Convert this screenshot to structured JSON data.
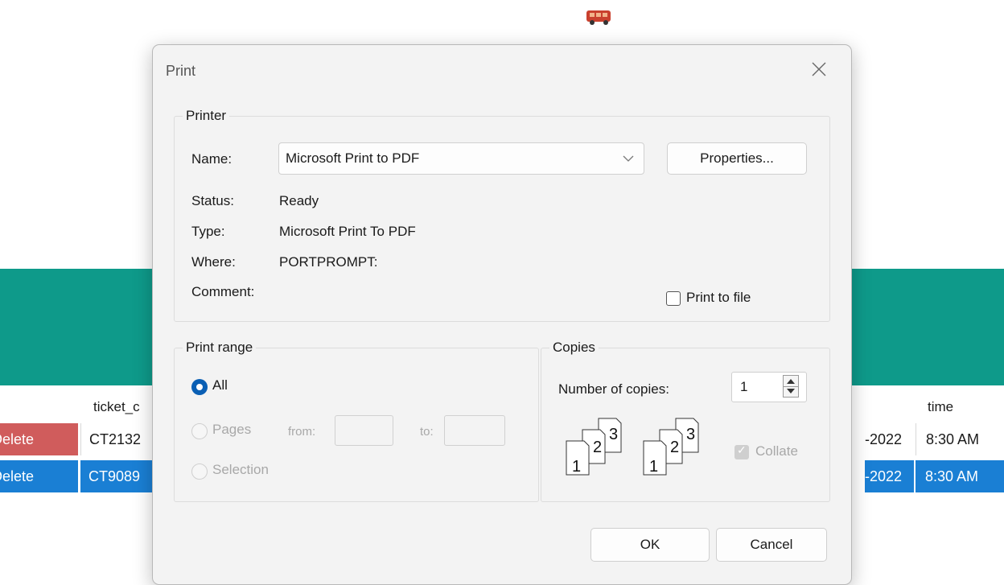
{
  "background": {
    "table_headers": {
      "col2": "ticket_c",
      "col_time": "time"
    },
    "rows": [
      {
        "action": "Delete",
        "ticket": "CT2132",
        "date": "-2022",
        "time": "8:30 AM",
        "selected": false
      },
      {
        "action": "Delete",
        "ticket": "CT9089",
        "date": "-2022",
        "time": "8:30 AM",
        "selected": true
      }
    ],
    "colors": {
      "teal": "#0e9a8a",
      "delete_red": "#d05c5c",
      "selection_blue": "#1a7fd4"
    }
  },
  "dialog": {
    "title": "Print",
    "printer_group": {
      "legend": "Printer",
      "name_label": "Name:",
      "name_value": "Microsoft Print to PDF",
      "properties_button": "Properties...",
      "status_label": "Status:",
      "status_value": "Ready",
      "type_label": "Type:",
      "type_value": "Microsoft Print To PDF",
      "where_label": "Where:",
      "where_value": "PORTPROMPT:",
      "comment_label": "Comment:",
      "print_to_file": "Print to file"
    },
    "range_group": {
      "legend": "Print range",
      "all": "All",
      "pages": "Pages",
      "from": "from:",
      "to": "to:",
      "selection": "Selection"
    },
    "copies_group": {
      "legend": "Copies",
      "number_label": "Number of copies:",
      "number_value": "1",
      "collate": "Collate"
    },
    "ok_button": "OK",
    "cancel_button": "Cancel"
  }
}
